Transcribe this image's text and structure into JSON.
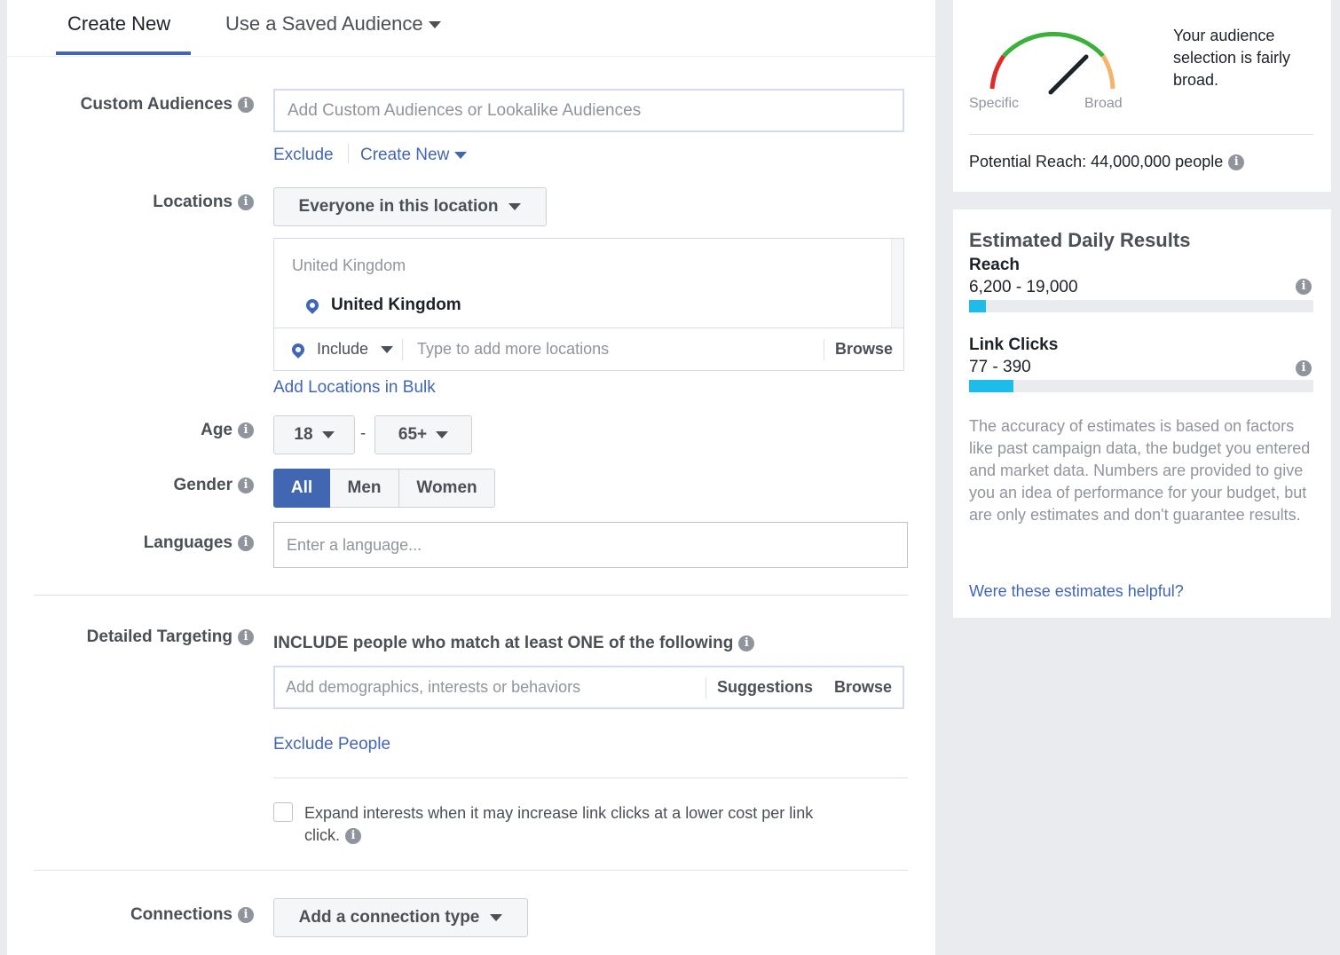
{
  "tabs": {
    "create_new": "Create New",
    "saved_audience": "Use a Saved Audience"
  },
  "custom_audiences": {
    "label": "Custom Audiences",
    "placeholder": "Add Custom Audiences or Lookalike Audiences",
    "exclude_link": "Exclude",
    "create_new_link": "Create New"
  },
  "locations": {
    "label": "Locations",
    "dropdown_value": "Everyone in this location",
    "group_header": "United Kingdom",
    "selected_location": "United Kingdom",
    "include_value": "Include",
    "placeholder": "Type to add more locations",
    "browse": "Browse",
    "bulk_link": "Add Locations in Bulk"
  },
  "age": {
    "label": "Age",
    "min": "18",
    "separator": "-",
    "max": "65+"
  },
  "gender": {
    "label": "Gender",
    "options": [
      "All",
      "Men",
      "Women"
    ],
    "selected": "All"
  },
  "languages": {
    "label": "Languages",
    "placeholder": "Enter a language..."
  },
  "detailed_targeting": {
    "label": "Detailed Targeting",
    "include_text": "INCLUDE people who match at least ONE of the following",
    "placeholder": "Add demographics, interests or behaviors",
    "suggestions": "Suggestions",
    "browse": "Browse",
    "exclude_link": "Exclude People",
    "expand_text_line1": "Expand interests when it may increase link clicks at a lower cost per link",
    "expand_text_line2": "click.",
    "expand_checked": false
  },
  "connections": {
    "label": "Connections",
    "dropdown_value": "Add a connection type"
  },
  "audience_meter": {
    "description": "Your audience selection is fairly broad.",
    "specific_label": "Specific",
    "broad_label": "Broad",
    "potential_reach": "Potential Reach: 44,000,000 people",
    "colors": {
      "specific": "#e02a2a",
      "middle": "#3bb13b",
      "broad": "#f5b36b"
    }
  },
  "estimated_results": {
    "title": "Estimated Daily Results",
    "reach_label": "Reach",
    "reach_value": "6,200 - 19,000",
    "reach_fill": 0.05,
    "clicks_label": "Link Clicks",
    "clicks_value": "77 - 390",
    "clicks_fill": 0.13,
    "disclaimer": "The accuracy of estimates is based on factors like past campaign data, the budget you entered and market data. Numbers are provided to give you an idea of performance for your budget, but are only estimates and don't guarantee results.",
    "feedback_link": "Were these estimates helpful?"
  }
}
